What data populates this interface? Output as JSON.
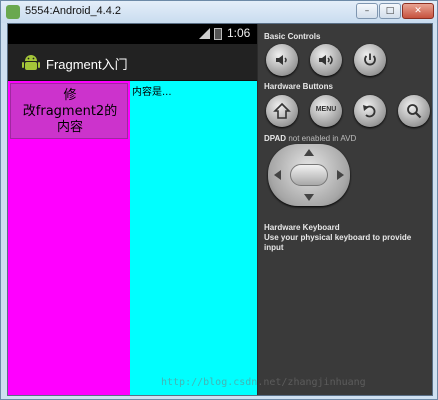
{
  "window": {
    "title": "5554:Android_4.4.2"
  },
  "status_bar": {
    "time": "1:06"
  },
  "action_bar": {
    "title": "Fragment入门"
  },
  "fragment1": {
    "button_label": "修\n改fragment2的\n内容",
    "bg_color": "#ff00ff"
  },
  "fragment2": {
    "content_text": "内容是...",
    "bg_color": "#00ffff"
  },
  "panel": {
    "basic_controls_label": "Basic Controls",
    "hardware_buttons_label": "Hardware Buttons",
    "menu_label": "MENU",
    "dpad_label": "DPAD",
    "dpad_status": "not enabled in AVD",
    "keyboard_label": "Hardware Keyboard",
    "keyboard_hint": "Use your physical keyboard to provide input"
  },
  "watermark": "http://blog.csdn.net/zhangjinhuang"
}
